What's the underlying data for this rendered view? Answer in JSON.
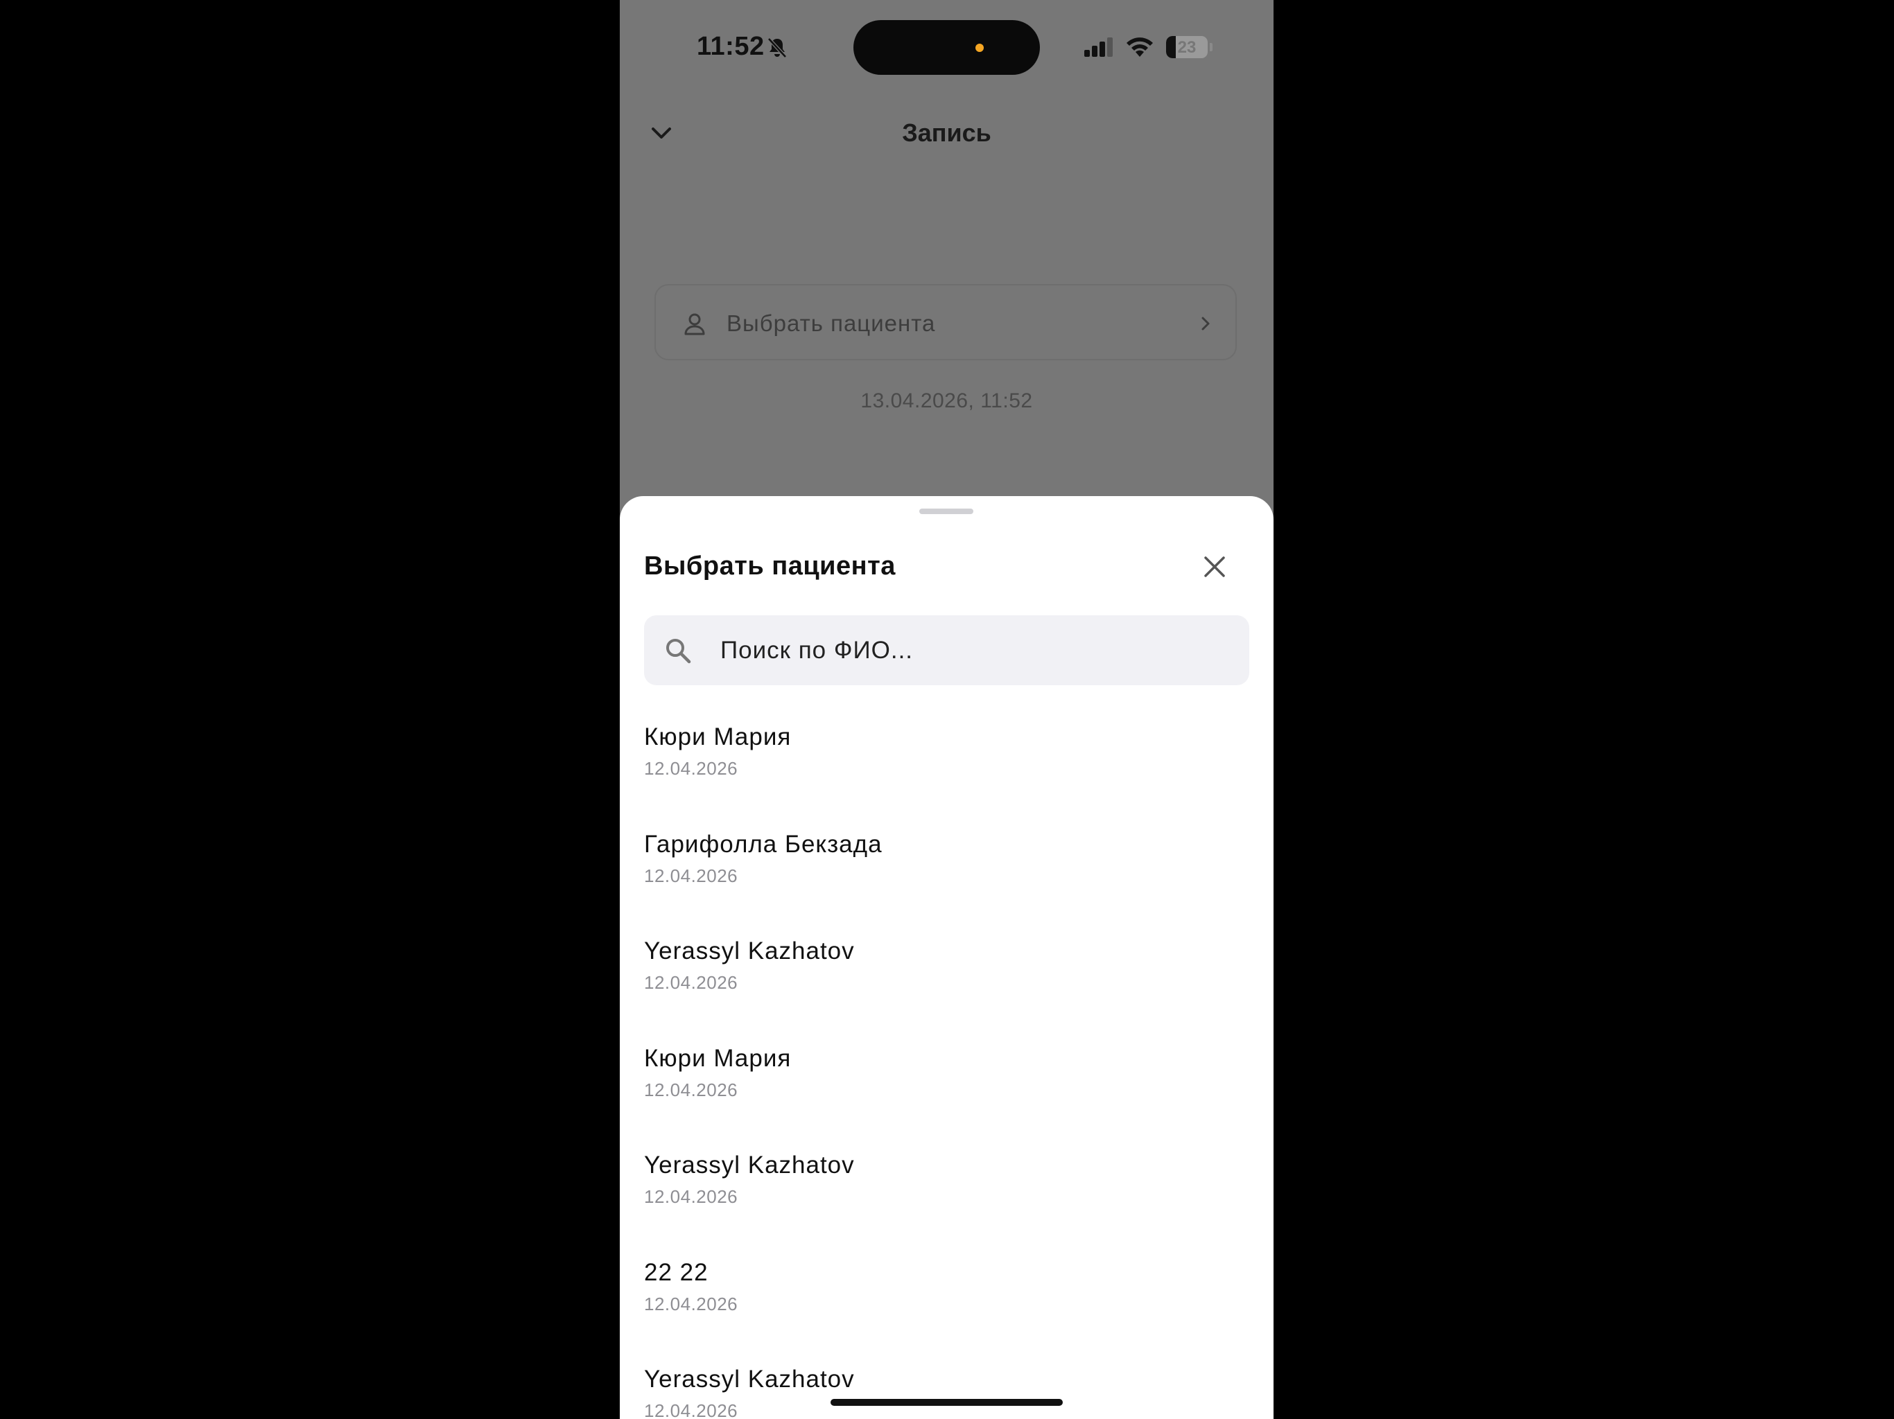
{
  "status_bar": {
    "time": "11:52",
    "battery_level": 23,
    "battery_text": "23",
    "icons": [
      "bell-slash-icon",
      "signal-icon",
      "wifi-icon",
      "battery-icon"
    ]
  },
  "screen": {
    "title": "Запись",
    "patient_select_label": "Выбрать пациента",
    "datetime": "13.04.2026, 11:52",
    "icons": [
      "chevron-down-icon",
      "person-icon",
      "chevron-right-icon"
    ]
  },
  "sheet": {
    "title": "Выбрать пациента",
    "search_placeholder": "Поиск по ФИО...",
    "icons": [
      "close-icon",
      "search-icon"
    ],
    "patients": [
      {
        "name": "Кюри Мария",
        "date": "12.04.2026"
      },
      {
        "name": "Гарифолла Бекзада",
        "date": "12.04.2026"
      },
      {
        "name": "Yerassyl Kazhatov",
        "date": "12.04.2026"
      },
      {
        "name": "Кюри Мария",
        "date": "12.04.2026"
      },
      {
        "name": "Yerassyl Kazhatov",
        "date": "12.04.2026"
      },
      {
        "name": "22 22",
        "date": "12.04.2026"
      },
      {
        "name": "Yerassyl Kazhatov",
        "date": "12.04.2026"
      }
    ]
  },
  "colors": {
    "overlay": "#777777",
    "sheet_bg": "#ffffff",
    "search_bg": "#f1f1f5",
    "secondary_text": "#8e8e93",
    "island_dot": "#f5a623"
  }
}
